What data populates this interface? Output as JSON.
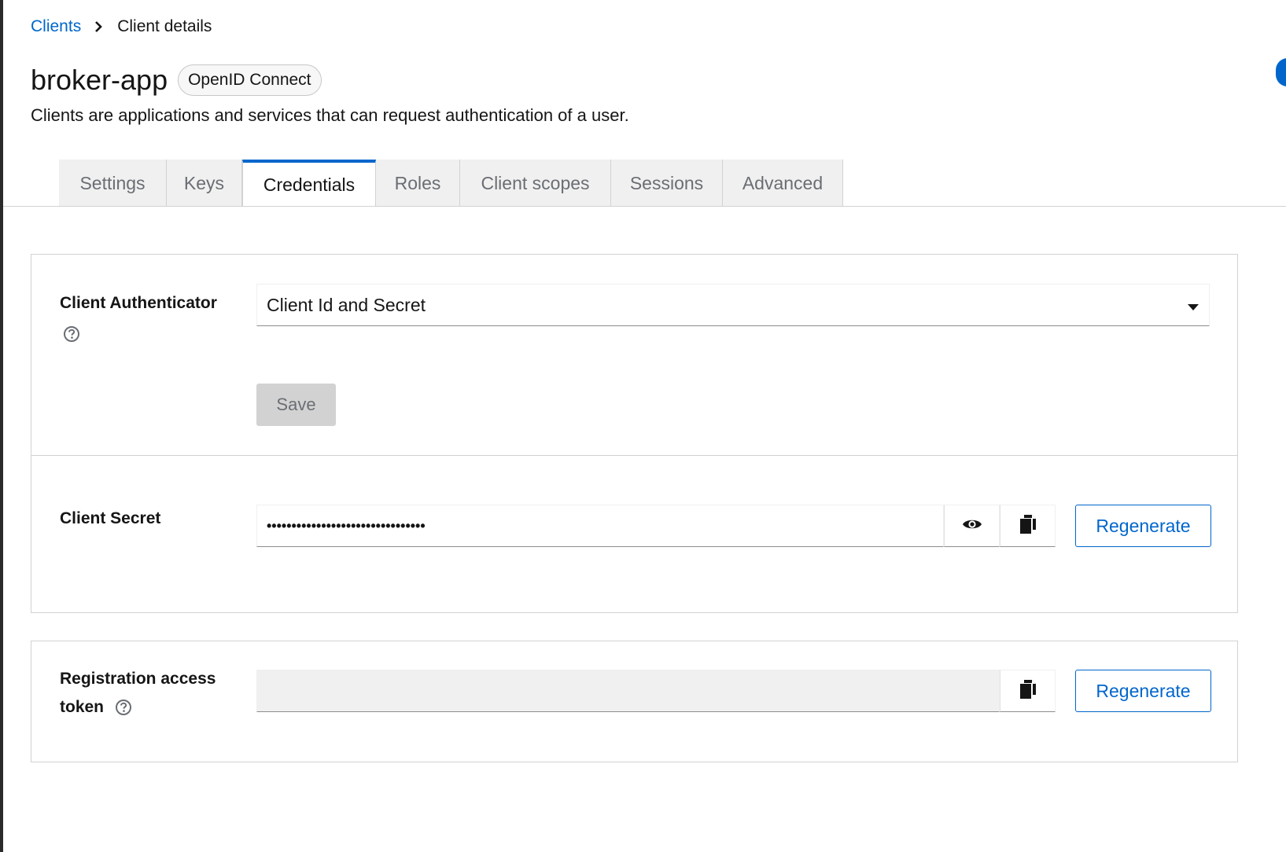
{
  "breadcrumb": {
    "parent": "Clients",
    "current": "Client details"
  },
  "header": {
    "title": "broker-app",
    "badge": "OpenID Connect",
    "description": "Clients are applications and services that can request authentication of a user."
  },
  "tabs": [
    {
      "label": "Settings",
      "active": false
    },
    {
      "label": "Keys",
      "active": false
    },
    {
      "label": "Credentials",
      "active": true
    },
    {
      "label": "Roles",
      "active": false
    },
    {
      "label": "Client scopes",
      "active": false
    },
    {
      "label": "Sessions",
      "active": false
    },
    {
      "label": "Advanced",
      "active": false
    }
  ],
  "client_authenticator": {
    "label": "Client Authenticator",
    "value": "Client Id and Secret",
    "save_label": "Save"
  },
  "client_secret": {
    "label": "Client Secret",
    "masked_value": "••••••••••••••••••••••••••••••••",
    "regenerate_label": "Regenerate"
  },
  "registration_token": {
    "label_line1": "Registration access",
    "label_line2": "token",
    "value": "",
    "regenerate_label": "Regenerate"
  },
  "icons": {
    "breadcrumb_separator": "chevron-right-icon",
    "help": "help-circle-icon",
    "dropdown": "caret-down-icon",
    "show": "eye-icon",
    "copy": "copy-icon"
  },
  "colors": {
    "accent": "#0066cc",
    "text": "#151515",
    "muted": "#6a6e73",
    "border": "#d2d2d2"
  }
}
